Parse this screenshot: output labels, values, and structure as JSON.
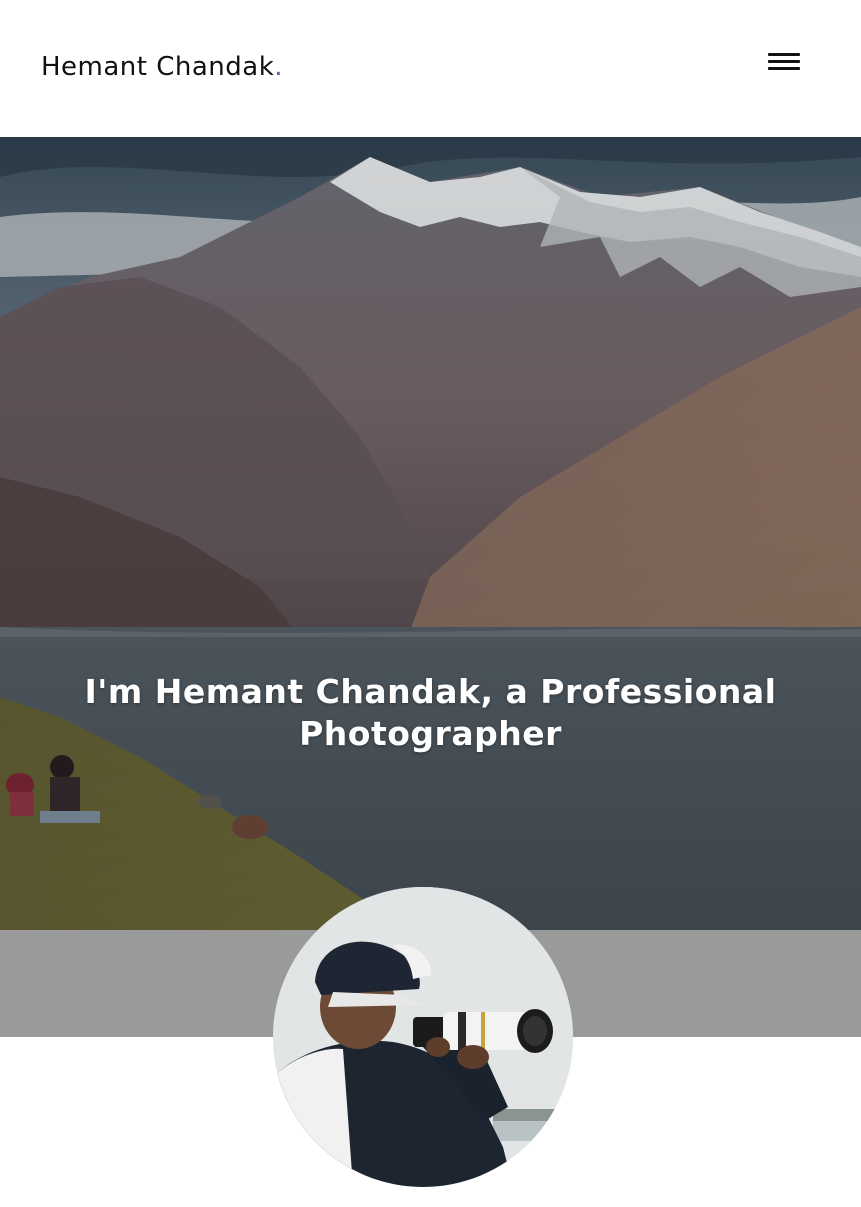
{
  "header": {
    "brand_name": "Hemant Chandak",
    "brand_dot": ".",
    "brand_dot_color": "#6b4bd6",
    "menu_icon": "hamburger-menu-icon"
  },
  "hero": {
    "title": "I'm Hemant Chandak, a Professional Photographer",
    "background": "mountain-lake-photo"
  },
  "profile": {
    "avatar": "photographer-with-telephoto-lens-photo"
  },
  "colors": {
    "band_gray": "#9a9a9a",
    "text_dark": "#111111"
  }
}
